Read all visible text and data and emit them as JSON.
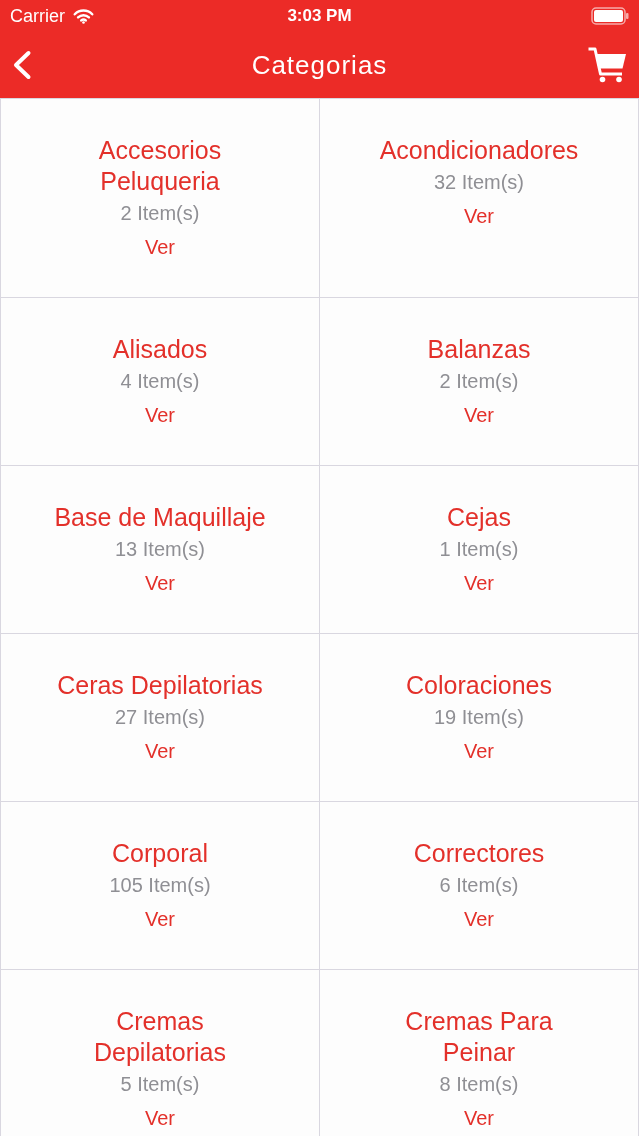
{
  "status_bar": {
    "carrier": "Carrier",
    "time": "3:03 PM"
  },
  "header": {
    "title": "Categorias"
  },
  "categories": [
    {
      "name": "Accesorios Peluqueria",
      "count": "2 Item(s)",
      "link": "Ver"
    },
    {
      "name": "Acondicionadores",
      "count": "32 Item(s)",
      "link": "Ver"
    },
    {
      "name": "Alisados",
      "count": "4 Item(s)",
      "link": "Ver"
    },
    {
      "name": "Balanzas",
      "count": "2 Item(s)",
      "link": "Ver"
    },
    {
      "name": "Base de Maquillaje",
      "count": "13 Item(s)",
      "link": "Ver"
    },
    {
      "name": "Cejas",
      "count": "1 Item(s)",
      "link": "Ver"
    },
    {
      "name": "Ceras Depilatorias",
      "count": "27 Item(s)",
      "link": "Ver"
    },
    {
      "name": "Coloraciones",
      "count": "19 Item(s)",
      "link": "Ver"
    },
    {
      "name": "Corporal",
      "count": "105 Item(s)",
      "link": "Ver"
    },
    {
      "name": "Correctores",
      "count": "6 Item(s)",
      "link": "Ver"
    },
    {
      "name": "Cremas Depilatorias",
      "count": "5 Item(s)",
      "link": "Ver"
    },
    {
      "name": "Cremas Para Peinar",
      "count": "8 Item(s)",
      "link": "Ver"
    }
  ]
}
